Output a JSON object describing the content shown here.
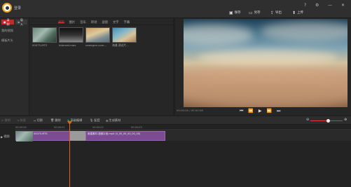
{
  "titlebar": {
    "username": "登录",
    "buttons": [
      {
        "icon": "save-icon",
        "label": "保存"
      },
      {
        "icon": "folder-icon",
        "label": "另存"
      },
      {
        "icon": "export-icon",
        "label": "导出"
      },
      {
        "icon": "upload-icon",
        "label": "上传"
      }
    ],
    "window_controls": [
      "?",
      "⚙",
      "—",
      "✕"
    ]
  },
  "sidebar": {
    "record_label": "录制",
    "import_label": "导入",
    "items": [
      "我的视频",
      "模板片头"
    ]
  },
  "library": {
    "tabs": [
      "视频",
      "图片",
      "音乐",
      "转场",
      "滤镜",
      "文字",
      "字幕"
    ],
    "active_tab": 0,
    "items": [
      {
        "name": "00075.MTS"
      },
      {
        "name": "Internet.mov"
      },
      {
        "name": "newcgen.com..."
      },
      {
        "name": "海滩.测试片..."
      }
    ]
  },
  "preview": {
    "timecode": "00:00:00 / 00:00:56",
    "controls": [
      "⏮",
      "⏪",
      "▶",
      "⏩",
      "⏭"
    ]
  },
  "toolbar": {
    "tools": [
      {
        "icon": "undo-icon",
        "label": "撤销",
        "enabled": false
      },
      {
        "icon": "redo-icon",
        "label": "恢复",
        "enabled": false
      },
      {
        "icon": "cut-icon",
        "label": "切割",
        "enabled": true
      },
      {
        "icon": "delete-icon",
        "label": "删除",
        "enabled": true
      },
      {
        "icon": "edit-icon",
        "label": "高级编辑",
        "enabled": true
      },
      {
        "icon": "mic-icon",
        "label": "配音",
        "enabled": true
      },
      {
        "icon": "merge-icon",
        "label": "生成素材",
        "enabled": true
      }
    ],
    "zoom_level": 0.55
  },
  "timeline": {
    "ruler_ticks": [
      "00:00:00",
      "00:00:01",
      "00:00:02",
      "00:00:03"
    ],
    "track_label": "视频",
    "clips": [
      {
        "label": "00075.MTS"
      },
      {
        "label": ""
      },
      {
        "label": "新建素材-视频片段.mp4 (0_00_00_00_00_00)"
      }
    ]
  },
  "colors": {
    "accent": "#e53935",
    "playhead": "#e8601c",
    "clip": "#7b4b94"
  }
}
